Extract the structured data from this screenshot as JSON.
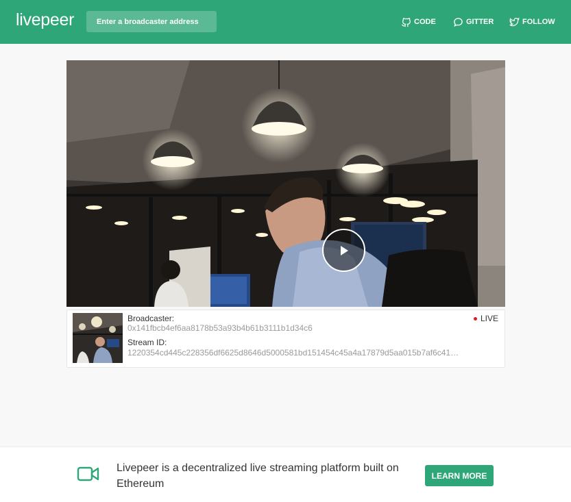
{
  "header": {
    "logo": "livepeer",
    "search_placeholder": "Enter a broadcaster address",
    "nav": [
      {
        "label": "CODE",
        "icon": "github-icon"
      },
      {
        "label": "GITTER",
        "icon": "chat-bubble-icon"
      },
      {
        "label": "FOLLOW",
        "icon": "twitter-icon"
      }
    ]
  },
  "stream": {
    "broadcaster_label": "Broadcaster:",
    "broadcaster_value": "0x141fbcb4ef6aa8178b53a93b4b61b3111b1d34c6",
    "stream_id_label": "Stream ID:",
    "stream_id_value": "1220354cd445c228356df6625d8646d5000581bd151454c45a4a17879d5aa015b7af6c41…",
    "status": "LIVE",
    "status_color": "#e01b1b"
  },
  "footer": {
    "text": "Livepeer is a decentralized live streaming platform built on Ethereum",
    "button": "LEARN MORE"
  },
  "colors": {
    "brand": "#2ea678"
  }
}
